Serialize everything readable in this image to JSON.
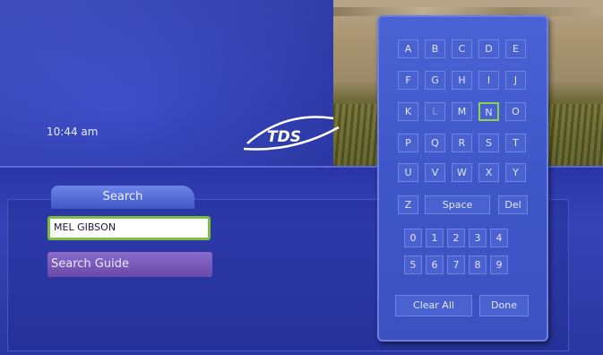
{
  "status": {
    "time": "10:44 am"
  },
  "brand": {
    "logo_text": "TDS"
  },
  "search": {
    "tab_label": "Search",
    "input_value": "MEL GIBSON",
    "guide_button": "Search Guide"
  },
  "keyboard": {
    "letters": [
      "A",
      "B",
      "C",
      "D",
      "E",
      "F",
      "G",
      "H",
      "I",
      "J",
      "K",
      "L",
      "M",
      "N",
      "O",
      "P",
      "Q",
      "R",
      "S",
      "T",
      "U",
      "V",
      "W",
      "X",
      "Y",
      "Z"
    ],
    "space": "Space",
    "del": "Del",
    "digits": [
      "0",
      "1",
      "2",
      "3",
      "4",
      "5",
      "6",
      "7",
      "8",
      "9"
    ],
    "clear_all": "Clear All",
    "done": "Done",
    "selected_key": "N",
    "disabled_keys": [
      "L"
    ]
  },
  "colors": {
    "focus_ring": "#7ebd3f",
    "panel_blue": "#2b379f",
    "purple_button": "#7a5bbb"
  }
}
